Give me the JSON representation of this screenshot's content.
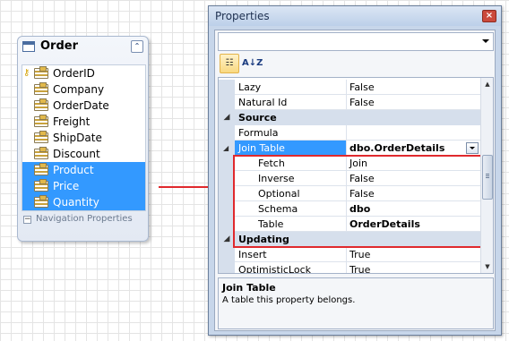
{
  "entity": {
    "title": "Order",
    "collapse_glyph": "⌃",
    "properties": [
      {
        "name": "OrderID",
        "key": true,
        "nav": false
      },
      {
        "name": "Company",
        "key": false,
        "nav": false
      },
      {
        "name": "OrderDate",
        "key": false,
        "nav": false
      },
      {
        "name": "Freight",
        "key": false,
        "nav": false
      },
      {
        "name": "ShipDate",
        "key": false,
        "nav": false
      },
      {
        "name": "Discount",
        "key": false,
        "nav": false
      },
      {
        "name": "Product",
        "key": false,
        "nav": true
      },
      {
        "name": "Price",
        "key": false,
        "nav": true
      },
      {
        "name": "Quantity",
        "key": false,
        "nav": true
      }
    ],
    "nav_section_label": "Navigation Properties"
  },
  "properties_window": {
    "title": "Properties",
    "close_glyph": "×",
    "toolbar": {
      "categorized_glyph": "☷",
      "alphabetical_glyph": "A↓Z"
    },
    "rows": [
      {
        "kind": "prop",
        "name": "Lazy",
        "value": "False"
      },
      {
        "kind": "prop",
        "name": "Natural Id",
        "value": "False"
      },
      {
        "kind": "category",
        "name": "Source"
      },
      {
        "kind": "prop",
        "name": "Formula",
        "value": ""
      },
      {
        "kind": "prop",
        "name": "Join Table",
        "value": "dbo.OrderDetails",
        "selected": true,
        "bold": true,
        "expandable": true,
        "dropdown": true
      },
      {
        "kind": "sub",
        "name": "Fetch",
        "value": "Join"
      },
      {
        "kind": "sub",
        "name": "Inverse",
        "value": "False"
      },
      {
        "kind": "sub",
        "name": "Optional",
        "value": "False"
      },
      {
        "kind": "sub",
        "name": "Schema",
        "value": "dbo",
        "bold": true
      },
      {
        "kind": "sub",
        "name": "Table",
        "value": "OrderDetails",
        "bold": true
      },
      {
        "kind": "category",
        "name": "Updating"
      },
      {
        "kind": "prop",
        "name": "Insert",
        "value": "True"
      },
      {
        "kind": "prop",
        "name": "OptimisticLock",
        "value": "True"
      }
    ],
    "description": {
      "title": "Join Table",
      "text": "A table this property belongs."
    }
  },
  "icons": {
    "key": "key-icon",
    "property": "property-icon",
    "entity": "entity-icon"
  },
  "colors": {
    "selection": "#3399ff",
    "highlight_border": "#e0292d",
    "category_bg": "#d6dfec"
  }
}
